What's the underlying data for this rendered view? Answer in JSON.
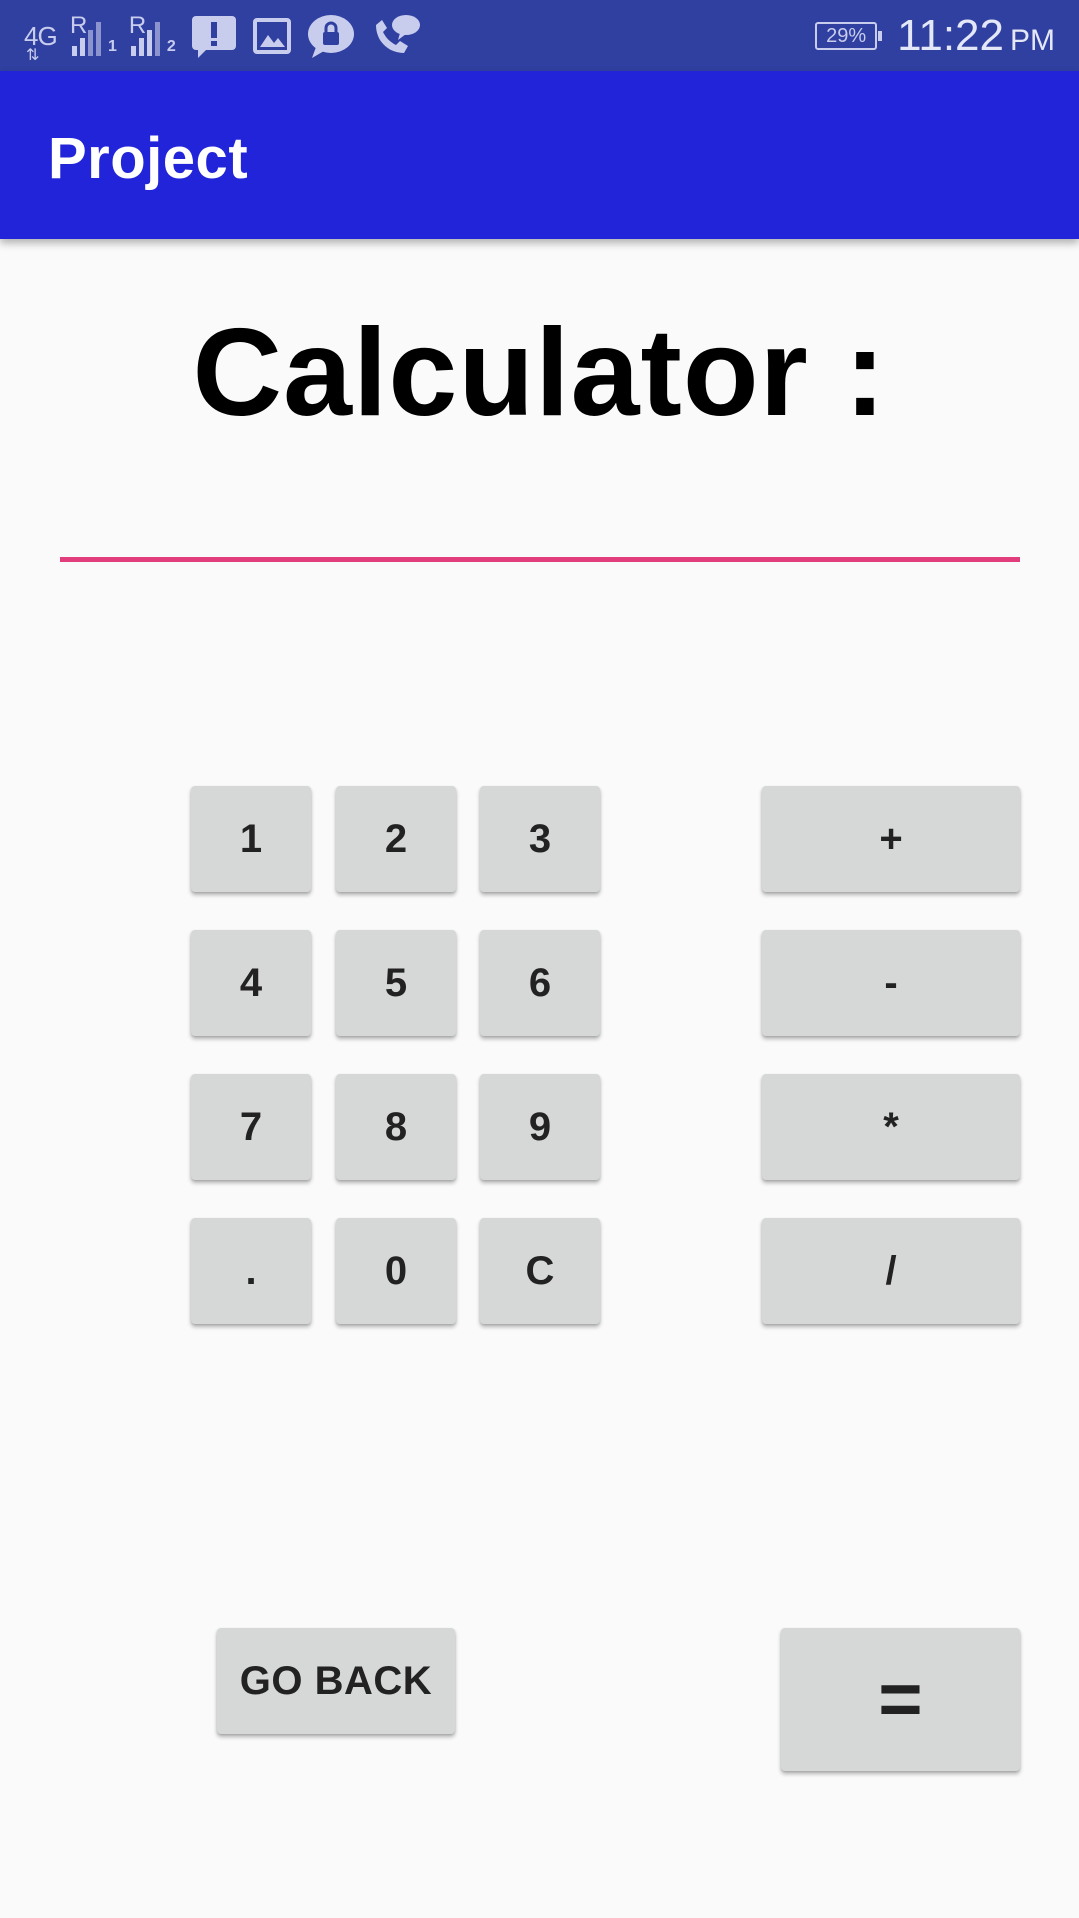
{
  "status_bar": {
    "network": "4G",
    "sim1_label": "1",
    "sim2_label": "2",
    "battery": "29%",
    "time": "11:22",
    "ampm": "PM"
  },
  "app_bar": {
    "title": "Project"
  },
  "main": {
    "heading": "Calculator :",
    "display_value": "",
    "keypad": [
      "1",
      "2",
      "3",
      "4",
      "5",
      "6",
      "7",
      "8",
      "9",
      ".",
      "0",
      "C"
    ],
    "operators": [
      "+",
      "-",
      "*",
      "/"
    ],
    "go_back_label": "GO BACK",
    "equals_label": "="
  },
  "colors": {
    "status_bar": "#3040a0",
    "app_bar": "#2124d8",
    "accent_underline": "#e23e7d",
    "button": "#d6d7d7",
    "background": "#fafafa"
  }
}
